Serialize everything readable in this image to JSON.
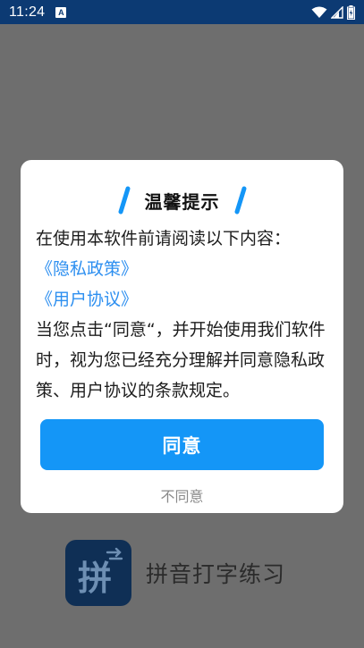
{
  "status_bar": {
    "time": "11:24",
    "notification_icon": "a-notification-icon",
    "wifi_icon": "wifi-icon",
    "signal_icon": "signal-icon",
    "battery_icon": "battery-icon"
  },
  "background": {
    "app_icon_char": "拼",
    "app_name": "拼音打字练习"
  },
  "dialog": {
    "title": "温馨提示",
    "intro": "在使用本软件前请阅读以下内容：",
    "privacy_link": "《隐私政策》",
    "agreement_link": "《用户协议》",
    "notice": "当您点击“同意“，并开始使用我们软件时，视为您已经充分理解并同意隐私政策、用户协议的条款规定。",
    "agree_label": "同意",
    "disagree_label": "不同意"
  },
  "colors": {
    "accent": "#1496f7",
    "link": "#2d8ff0",
    "status_bar": "#0c3a73",
    "overlay": "#6e6e6e"
  }
}
